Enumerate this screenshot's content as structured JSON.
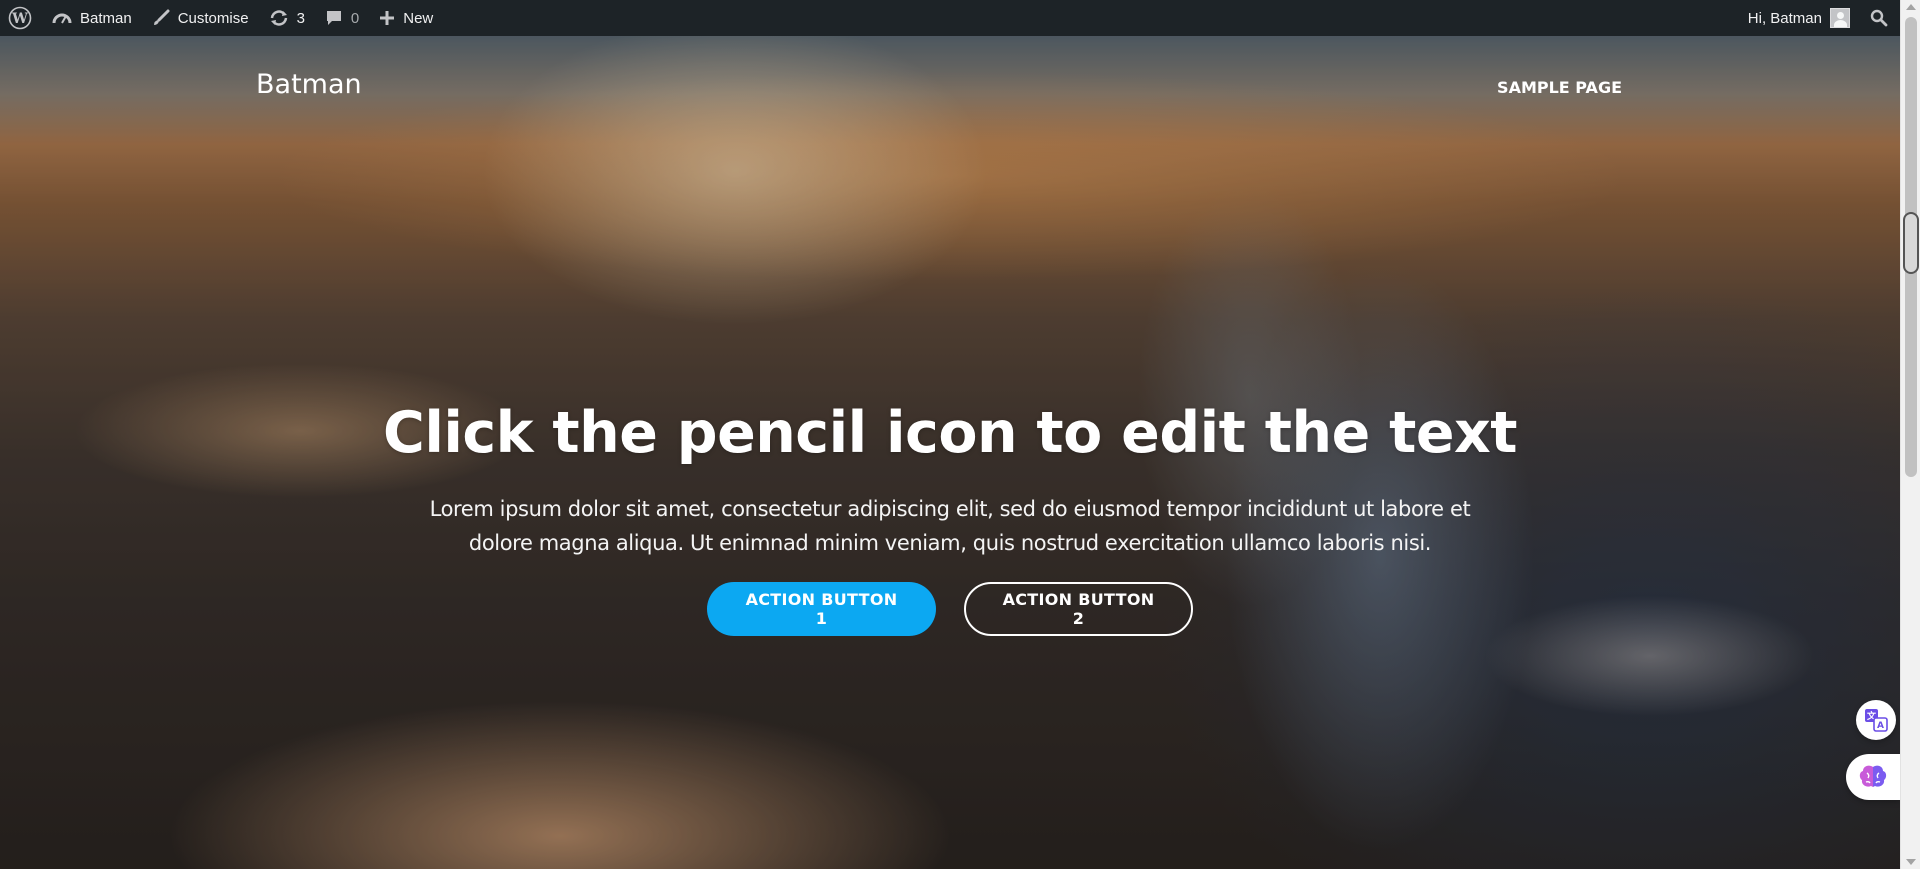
{
  "adminbar": {
    "site_name": "Batman",
    "customise_label": "Customise",
    "updates_count": "3",
    "comments_count": "0",
    "new_label": "New",
    "greeting": "Hi, Batman"
  },
  "header": {
    "site_title": "Batman",
    "nav": [
      "SAMPLE PAGE"
    ]
  },
  "hero": {
    "heading": "Click the pencil icon to edit the text",
    "text": "Lorem ipsum dolor sit amet, consectetur adipiscing elit, sed do eiusmod tempor incididunt ut labore et dolore magna aliqua. Ut enimnad minim veniam, quis nostrud exercitation ullamco laboris nisi.",
    "button_1": "ACTION BUTTON 1",
    "button_2": "ACTION BUTTON 2"
  },
  "colors": {
    "adminbar_bg": "#1d2327",
    "primary_button": "#0ca8f2"
  },
  "icons": {
    "adminbar": [
      "wordpress-icon",
      "dashboard-icon",
      "brush-icon",
      "updates-icon",
      "comment-icon",
      "plus-icon",
      "avatar",
      "search-icon"
    ],
    "floating": [
      "translate-icon",
      "brain-icon"
    ]
  }
}
